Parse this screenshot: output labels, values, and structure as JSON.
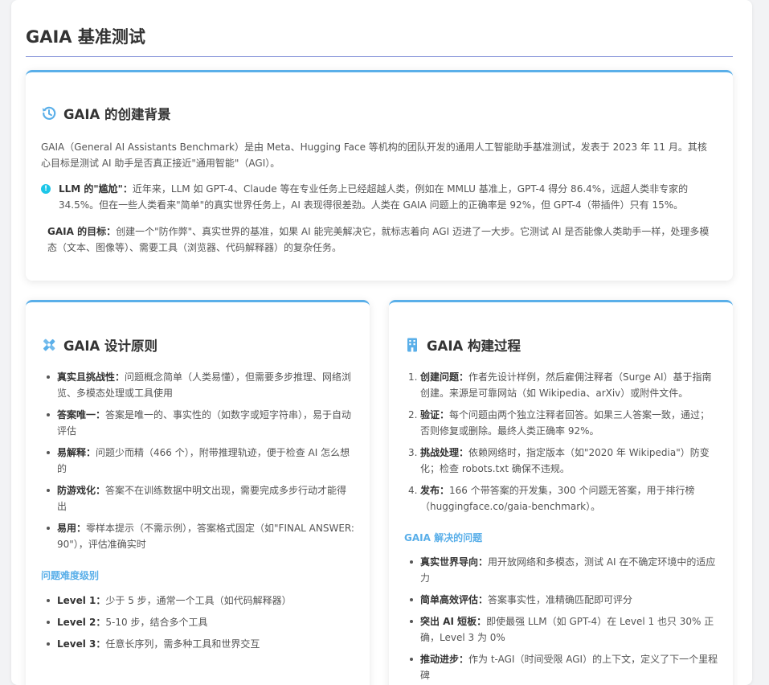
{
  "page_title": "GAIA 基准测试",
  "colors": {
    "accent": "#5aafe9",
    "rule": "#7b8bd6",
    "info": "#1cc6e8"
  },
  "background": {
    "icon": "history-icon",
    "title": "GAIA 的创建背景",
    "intro": "GAIA（General AI Assistants Benchmark）是由 Meta、Hugging Face 等机构的团队开发的通用人工智能助手基准测试，发表于 2023 年 11 月。其核心目标是测试 AI 助手是否真正接近\"通用智能\"（AGI）。",
    "note_label": "LLM 的\"尴尬\"：",
    "note_text": "近年来，LLM 如 GPT-4、Claude 等在专业任务上已经超越人类，例如在 MMLU 基准上，GPT-4 得分 86.4%，远超人类非专家的 34.5%。但在一些人类看来\"简单\"的真实世界任务上，AI 表现得很差劲。人类在 GAIA 问题上的正确率是 92%，但 GPT-4（带插件）只有 15%。",
    "goal_label": "GAIA 的目标：",
    "goal_text": "创建一个\"防作弊\"、真实世界的基准，如果 AI 能完美解决它，就标志着向 AGI 迈进了一大步。它测试 AI 是否能像人类助手一样，处理多模态（文本、图像等）、需要工具（浏览器、代码解释器）的复杂任务。"
  },
  "design": {
    "icon": "design-tools-icon",
    "title": "GAIA 设计原则",
    "principles": [
      {
        "label": "真实且挑战性：",
        "text": "问题概念简单（人类易懂），但需要多步推理、网络浏览、多模态处理或工具使用"
      },
      {
        "label": "答案唯一：",
        "text": "答案是唯一的、事实性的（如数字或短字符串），易于自动评估"
      },
      {
        "label": "易解释：",
        "text": "问题少而精（466 个），附带推理轨迹，便于检查 AI 怎么想的"
      },
      {
        "label": "防游戏化：",
        "text": "答案不在训练数据中明文出现，需要完成多步行动才能得出"
      },
      {
        "label": "易用：",
        "text": "零样本提示（不需示例），答案格式固定（如\"FINAL ANSWER: 90\"），评估准确实时"
      }
    ],
    "levels_title": "问题难度级别",
    "levels": [
      {
        "label": "Level 1：",
        "text": "少于 5 步，通常一个工具（如代码解释器）"
      },
      {
        "label": "Level 2：",
        "text": "5-10 步，结合多个工具"
      },
      {
        "label": "Level 3：",
        "text": "任意长序列，需多种工具和世界交互"
      }
    ]
  },
  "build": {
    "icon": "building-icon",
    "title": "GAIA 构建过程",
    "steps": [
      {
        "num": "1.",
        "label": "创建问题：",
        "text": "作者先设计样例，然后雇佣注释者（Surge AI）基于指南创建。来源是可靠网站（如 Wikipedia、arXiv）或附件文件。"
      },
      {
        "num": "2.",
        "label": "验证：",
        "text": "每个问题由两个独立注释者回答。如果三人答案一致，通过；否则修复或删除。最终人类正确率 92%。"
      },
      {
        "num": "3.",
        "label": "挑战处理：",
        "text": "依赖网络时，指定版本（如\"2020 年 Wikipedia\"）防变化；检查 robots.txt 确保不违规。"
      },
      {
        "num": "4.",
        "label": "发布：",
        "text": "166 个带答案的开发集，300 个问题无答案，用于排行榜（huggingface.co/gaia-benchmark）。"
      }
    ],
    "solved_title": "GAIA 解决的问题",
    "solved": [
      {
        "label": "真实世界导向：",
        "text": "用开放网络和多模态，测试 AI 在不确定环境中的适应力"
      },
      {
        "label": "简单高效评估：",
        "text": "答案事实性，准精确匹配即可评分"
      },
      {
        "label": "突出 AI 短板：",
        "text": "即使最强 LLM（如 GPT-4）在 Level 1 也只 30% 正确，Level 3 为 0%"
      },
      {
        "label": "推动进步：",
        "text": "作为 t-AGI（时间受限 AGI）的上下文，定义了下一个里程碑"
      }
    ]
  }
}
